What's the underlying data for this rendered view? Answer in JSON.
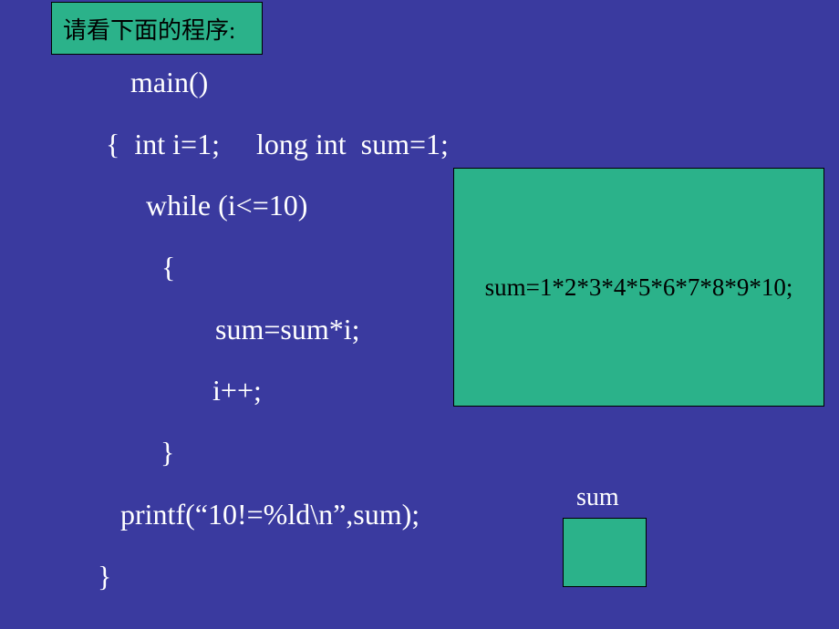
{
  "header": "请看下面的程序:",
  "code": {
    "l1": "main()",
    "l2": "{  int i=1;     long int  sum=1;",
    "l3": "while (i<=10)",
    "l4": "{",
    "l5": "sum=sum*i;",
    "l6": "i++;",
    "l7": "}",
    "l8": "printf(“10!=%ld\\n”,sum);",
    "l9": "}"
  },
  "explain": "sum=1*2*3*4*5*6*7*8*9*10;",
  "sum_label": "sum"
}
